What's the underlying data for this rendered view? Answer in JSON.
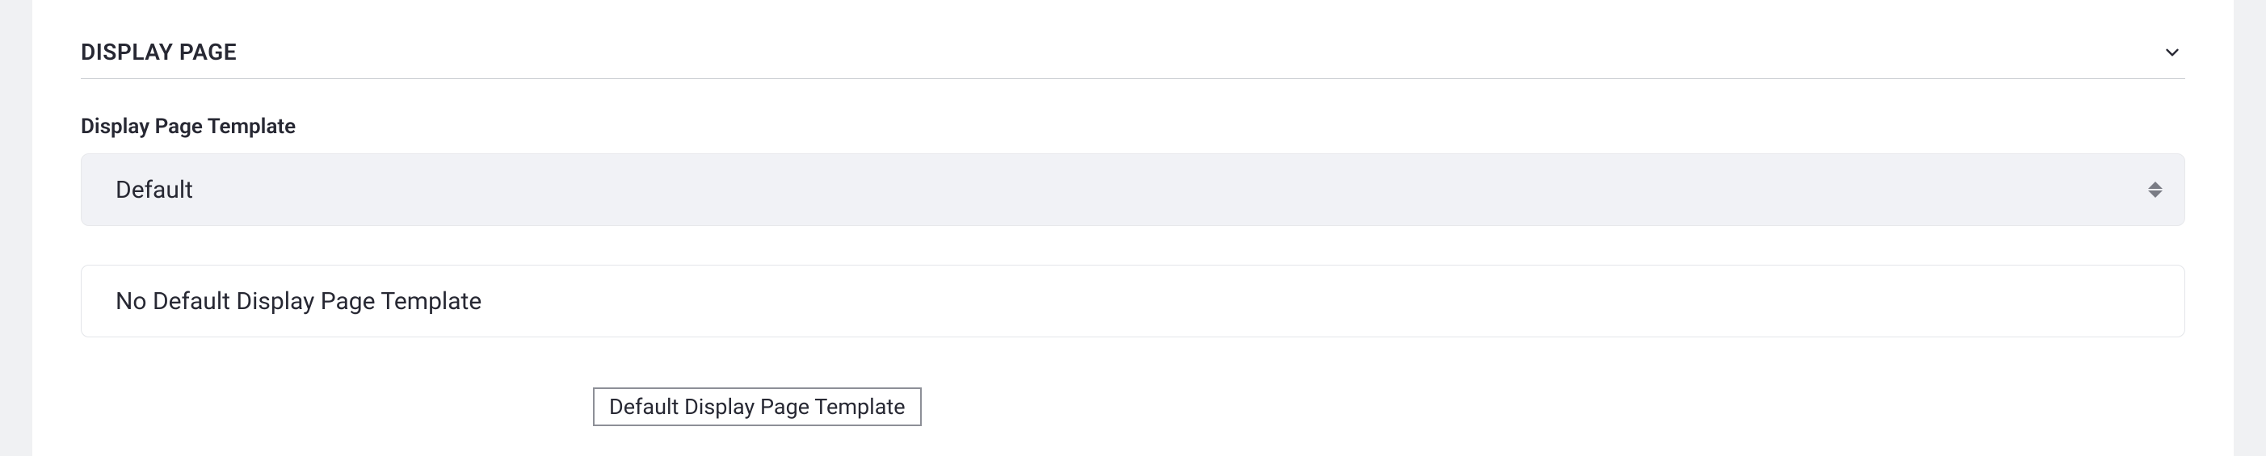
{
  "section": {
    "title": "DISPLAY PAGE"
  },
  "field": {
    "label": "Display Page Template",
    "selected": "Default"
  },
  "info": {
    "text": "No Default Display Page Template"
  },
  "tooltip": {
    "text": "Default Display Page Template"
  }
}
